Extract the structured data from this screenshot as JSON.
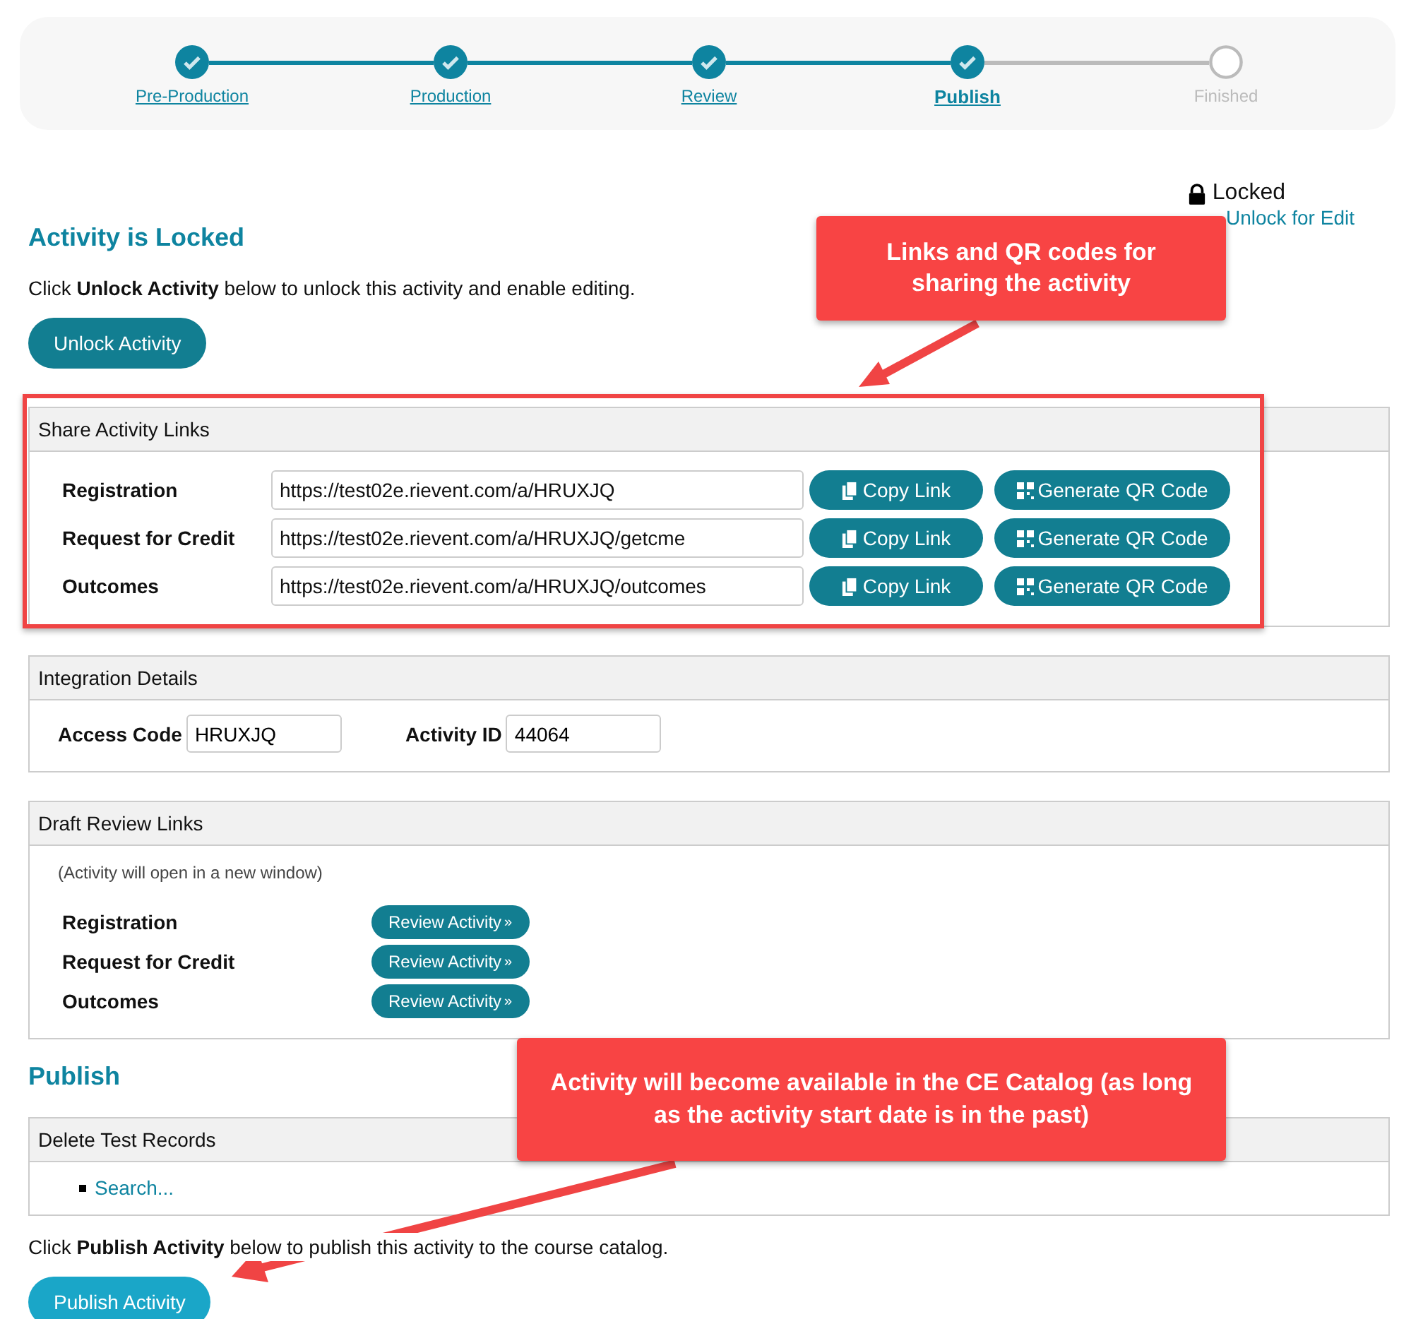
{
  "steps": [
    {
      "label": "Pre-Production",
      "done": true,
      "selected": false
    },
    {
      "label": "Production",
      "done": true,
      "selected": false
    },
    {
      "label": "Review",
      "done": true,
      "selected": false
    },
    {
      "label": "Publish",
      "done": true,
      "selected": true
    },
    {
      "label": "Finished",
      "done": false,
      "selected": false
    }
  ],
  "lock": {
    "status": "Locked",
    "link": "Unlock for Edit"
  },
  "locked_section": {
    "title": "Activity is Locked",
    "text": "Click **Unlock Activity** below to unlock this activity and enable editing.",
    "button": "Unlock Activity"
  },
  "share_links": {
    "title": "Share Activity Links",
    "rows": [
      {
        "label": "Registration",
        "url": "https://test02e.rievent.com/a/HRUXJQ",
        "copy_label": "Copy Link",
        "qr_label": "Generate QR Code"
      },
      {
        "label": "Request for Credit",
        "url": "https://test02e.rievent.com/a/HRUXJQ/getcme",
        "copy_label": "Copy Link",
        "qr_label": "Generate QR Code"
      },
      {
        "label": "Outcomes",
        "url": "https://test02e.rievent.com/a/HRUXJQ/outcomes",
        "copy_label": "Copy Link",
        "qr_label": "Generate QR Code"
      }
    ]
  },
  "integration": {
    "title": "Integration Details",
    "fields": [
      {
        "label": "Access Code",
        "value": "HRUXJQ"
      },
      {
        "label": "Activity ID",
        "value": "44064"
      }
    ]
  },
  "draft_review": {
    "title": "Draft Review Links",
    "note": "(Activity will open in a new window)",
    "rows": [
      {
        "label": "Registration",
        "button": "Review Activity",
        "button_mark": "»"
      },
      {
        "label": "Request for Credit",
        "button": "Review Activity",
        "button_mark": "»"
      },
      {
        "label": "Outcomes",
        "button": "Review Activity",
        "button_mark": "»"
      }
    ]
  },
  "publish": {
    "title": "Publish",
    "delete_title": "Delete Test Records",
    "search_link": "Search...",
    "text": "Click **Publish Activity** below to publish this activity to the course catalog.",
    "button": "Publish Activity"
  },
  "annotations": [
    {
      "kind": "callout",
      "text": "Links and QR codes for sharing the activity"
    },
    {
      "kind": "callout",
      "text": "Activity will become available in the CE Catalog (as long as the activity start date is in the past)"
    }
  ]
}
